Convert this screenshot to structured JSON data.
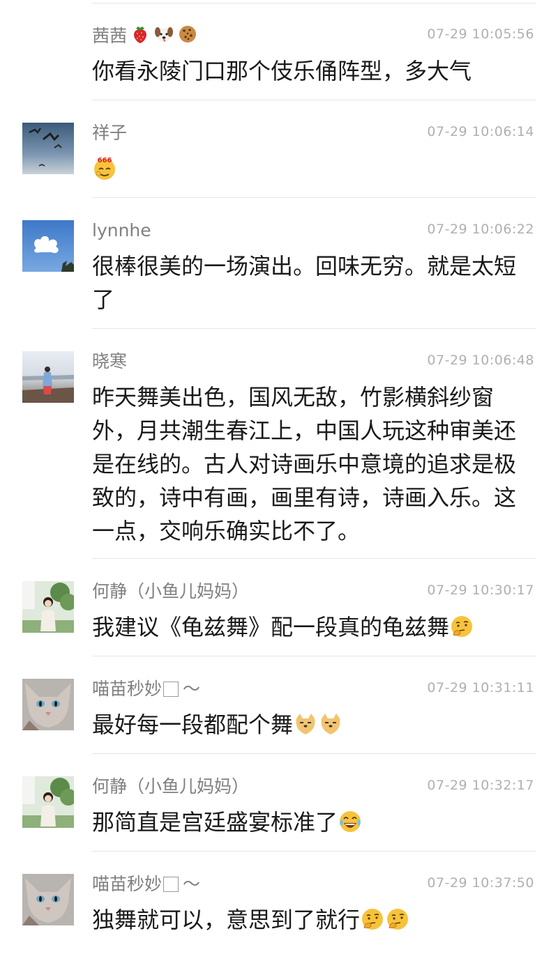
{
  "comments": [
    {
      "nickname": "茜茜",
      "nickname_emojis": [
        "strawberry-icon",
        "dog-face-icon",
        "cookie-icon"
      ],
      "time": "07-29 10:05:56",
      "content": "你看永陵门口那个伎乐俑阵型，多大气",
      "has_avatar": false
    },
    {
      "nickname": "祥子",
      "time": "07-29 10:06:14",
      "content": "",
      "content_emojis": [
        "666-emoji-icon"
      ],
      "avatar": "seagulls-sky-avatar"
    },
    {
      "nickname": "lynnhe",
      "time": "07-29 10:06:22",
      "content": "很棒很美的一场演出。回味无穷。就是太短了",
      "avatar": "heart-cloud-avatar"
    },
    {
      "nickname": "晓寒",
      "time": "07-29 10:06:48",
      "content": "昨天舞美出色，国风无敌，竹影横斜纱窗外，月共潮生春江上，中国人玩这种审美还是在线的。古人对诗画乐中意境的追求是极致的，诗中有画，画里有诗，诗画入乐。这一点，交响乐确实比不了。",
      "avatar": "beach-girl-avatar"
    },
    {
      "nickname": "何静（小鱼儿妈妈）",
      "time": "07-29 10:30:17",
      "content": "我建议《龟兹舞》配一段真的龟兹舞",
      "content_emojis": [
        "thinking-face-icon"
      ],
      "avatar": "woman-garden-avatar"
    },
    {
      "nickname": "喵苗秒妙",
      "nickname_suffix": "～",
      "time": "07-29 10:31:11",
      "content": "最好每一段都配个舞",
      "content_emojis": [
        "doge-icon",
        "doge-icon"
      ],
      "avatar": "sphynx-cat-avatar"
    },
    {
      "nickname": "何静（小鱼儿妈妈）",
      "time": "07-29 10:32:17",
      "content": "那简直是宫廷盛宴标准了",
      "content_emojis": [
        "laughing-tears-icon"
      ],
      "avatar": "woman-garden-avatar"
    },
    {
      "nickname": "喵苗秒妙",
      "nickname_suffix": "～",
      "time": "07-29 10:37:50",
      "content": "独舞就可以，意思到了就行",
      "content_emojis": [
        "thinking-face-icon",
        "thinking-face-icon"
      ],
      "avatar": "sphynx-cat-avatar"
    }
  ]
}
